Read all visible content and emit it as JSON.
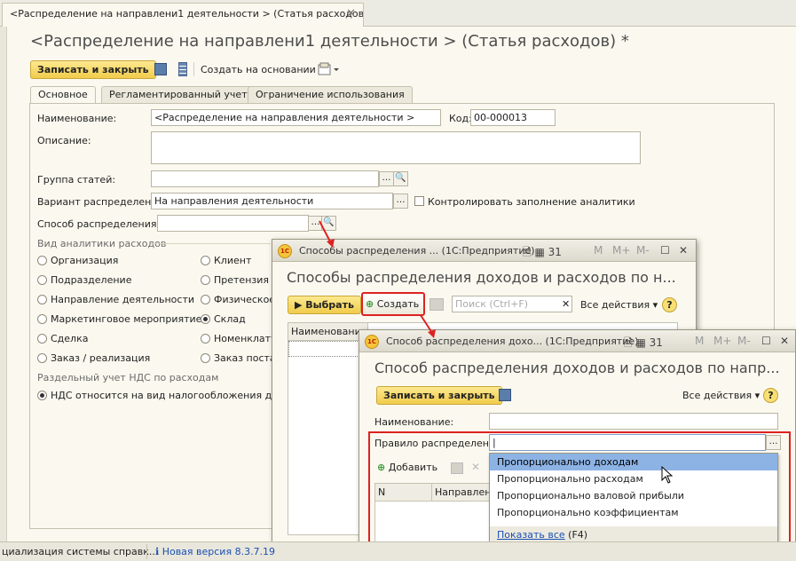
{
  "tabbar": {
    "tab_title": "<Распределение на направлени1 деятельности > (Статья расходов) *",
    "close": "✕"
  },
  "form": {
    "title": "<Распределение на направлени1 деятельности > (Статья расходов) *",
    "toolbar": {
      "save_close": "Записать и закрыть",
      "create_based": "Создать на основании ▾"
    },
    "tabs": [
      "Основное",
      "Регламентированный учет",
      "Ограничение использования"
    ],
    "fields": {
      "name_label": "Наименование:",
      "name_value": "<Распределение на направления деятельности >",
      "code_label": "Код:",
      "code_value": "00-000013",
      "desc_label": "Описание:",
      "group_label": "Группа статей:",
      "variant_label": "Вариант распределения:",
      "variant_value": "На направления деятельности",
      "control_label": "Контролировать заполнение аналитики",
      "method_label": "Способ распределения:"
    },
    "analytics_title": "Вид аналитики расходов",
    "radios_left": [
      "Организация",
      "Подразделение",
      "Направление деятельности",
      "Маркетинговое мероприятие",
      "Сделка",
      "Заказ / реализация"
    ],
    "radios_right": [
      "Клиент",
      "Претензия к",
      "Физическое",
      "Склад",
      "Номенклату",
      "Заказ поста"
    ],
    "selected_right": 3,
    "vat_title": "Раздельный учет НДС по расходам",
    "vat_option": "НДС относится на вид налогообложения докуме"
  },
  "win1": {
    "title": "Способы распределения ... (1С:Предприятие)",
    "heading": "Способы распределения доходов и расходов по н...",
    "select": "Выбрать",
    "create": "Создать",
    "search_placeholder": "Поиск (Ctrl+F)",
    "all_actions": "Все действия ▾",
    "col_name": "Наименование",
    "controls": [
      "M",
      "M+",
      "M-"
    ]
  },
  "win2": {
    "title": "Способ распределения дохо... (1С:Предприятие)",
    "heading": "Способ распределения доходов и расходов по напр...",
    "save_close": "Записать и закрыть",
    "all_actions": "Все действия ▾",
    "name_label": "Наименование:",
    "rule_label": "Правило распределения:",
    "add": "Добавить",
    "col_n": "N",
    "col_dir": "Направлени",
    "controls": [
      "M",
      "M+",
      "M-"
    ],
    "dropdown": [
      "Пропорционально доходам",
      "Пропорционально расходам",
      "Пропорционально валовой прибыли",
      "Пропорционально коэффициентам"
    ],
    "dropdown_selected": 0,
    "show_all": "Показать все",
    "show_all_key": "(F4)"
  },
  "status": {
    "left": "циализация системы справк...",
    "new_version": "Новая версия 8.3.7.19"
  },
  "colors": {
    "accent_red": "#d22222",
    "title_gray": "#4d4d4d",
    "highlight": "#8db3e5"
  }
}
